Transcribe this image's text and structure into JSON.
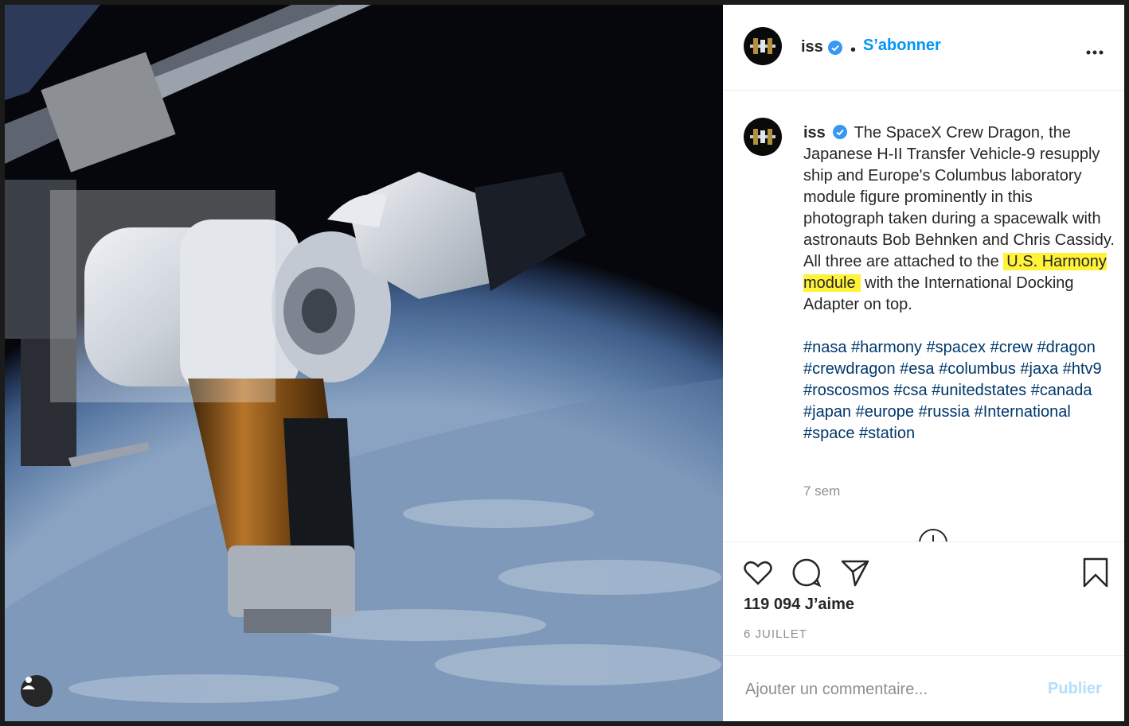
{
  "post": {
    "username": "iss",
    "follow_label": "S’abonner",
    "separator": "•",
    "more_label": "•••"
  },
  "caption": {
    "username": "iss",
    "text_before": "The SpaceX Crew Dragon, the Japanese H-II Transfer Vehicle-9 resupply ship and Europe's Columbus laboratory module figure prominently in this photograph taken during a spacewalk with astronauts Bob Behnken and Chris Cassidy. All three are attached to the ",
    "highlight": "U.S. Harmony module",
    "text_after": " with the International Docking Adapter on top.",
    "hashtags": "#nasa #harmony #spacex #crew #dragon #crewdragon #esa #columbus #jaxa #htv9 #roscosmos #csa #unitedstates #canada #japan #europe #russia #International #space #station",
    "time_ago": "7 sem"
  },
  "actions": {
    "likes": "119 094 J’aime",
    "date": "6 JUILLET"
  },
  "comment": {
    "placeholder": "Ajouter un commentaire...",
    "publish_label": "Publier"
  },
  "colors": {
    "accent": "#0095f6",
    "highlight": "#fff33a",
    "hashtag": "#00376b",
    "muted": "#8e8e8e"
  },
  "icons": {
    "verified": "verified-badge-icon",
    "like": "heart-icon",
    "comment": "comment-bubble-icon",
    "share": "paper-plane-icon",
    "save": "bookmark-icon",
    "load_more": "plus-circle-icon",
    "user": "user-icon"
  }
}
